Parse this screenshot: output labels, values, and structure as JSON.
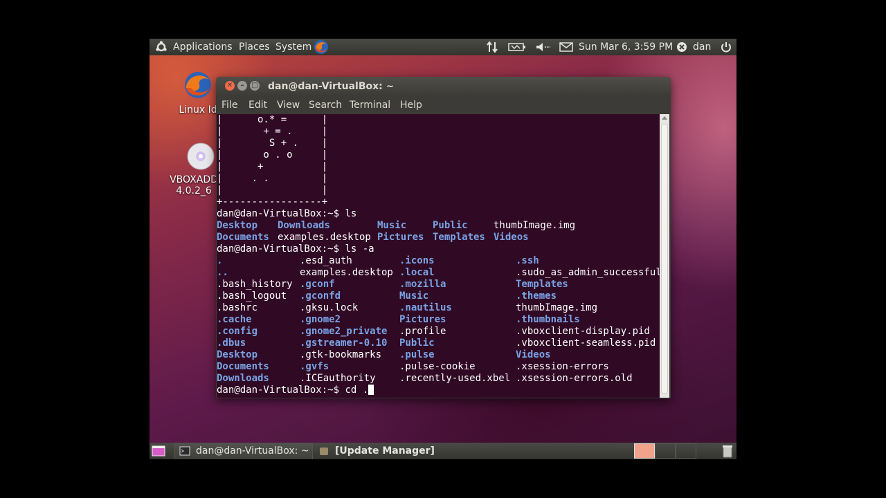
{
  "top_panel": {
    "menus": [
      "Applications",
      "Places",
      "System"
    ],
    "clock": "Sun Mar  6,  3:59 PM",
    "user": "dan"
  },
  "desktop_icons": [
    {
      "label_lines": [
        "Linux Id"
      ],
      "icon": "firefox-icon"
    },
    {
      "label_lines": [
        "VBOXADD",
        "4.0.2_6"
      ],
      "icon": "cd-icon"
    }
  ],
  "terminal": {
    "title": "dan@dan-VirtualBox: ~",
    "menu": [
      "File",
      "Edit",
      "View",
      "Search",
      "Terminal",
      "Help"
    ],
    "art_lines": [
      "|      o.* =      |",
      "|       + = .     |",
      "|        S + .    |",
      "|       o . o     |",
      "|      +          |",
      "|     . .         |",
      "|                 |",
      "+-----------------+"
    ],
    "prompt": "dan@dan-VirtualBox:~$",
    "cmd_ls": "ls",
    "ls_rows": [
      [
        {
          "t": "Desktop",
          "d": true
        },
        {
          "t": "Downloads",
          "d": true
        },
        {
          "t": "Music",
          "d": true
        },
        {
          "t": "Public",
          "d": true
        },
        {
          "t": "thumbImage.img",
          "d": false
        }
      ],
      [
        {
          "t": "Documents",
          "d": true
        },
        {
          "t": "examples.desktop",
          "d": false
        },
        {
          "t": "Pictures",
          "d": true
        },
        {
          "t": "Templates",
          "d": true
        },
        {
          "t": "Videos",
          "d": true
        }
      ]
    ],
    "cmd_ls_a": "ls -a",
    "ls_a_rows": [
      [
        {
          "t": ".",
          "d": true
        },
        {
          "t": ".esd_auth",
          "d": false
        },
        {
          "t": ".icons",
          "d": true
        },
        {
          "t": ".ssh",
          "d": true
        }
      ],
      [
        {
          "t": "..",
          "d": true
        },
        {
          "t": "examples.desktop",
          "d": false
        },
        {
          "t": ".local",
          "d": true
        },
        {
          "t": ".sudo_as_admin_successful",
          "d": false
        }
      ],
      [
        {
          "t": ".bash_history",
          "d": false
        },
        {
          "t": ".gconf",
          "d": true
        },
        {
          "t": ".mozilla",
          "d": true
        },
        {
          "t": "Templates",
          "d": true
        }
      ],
      [
        {
          "t": ".bash_logout",
          "d": false
        },
        {
          "t": ".gconfd",
          "d": true
        },
        {
          "t": "Music",
          "d": true
        },
        {
          "t": ".themes",
          "d": true
        }
      ],
      [
        {
          "t": ".bashrc",
          "d": false
        },
        {
          "t": ".gksu.lock",
          "d": false
        },
        {
          "t": ".nautilus",
          "d": true
        },
        {
          "t": "thumbImage.img",
          "d": false
        }
      ],
      [
        {
          "t": ".cache",
          "d": true
        },
        {
          "t": ".gnome2",
          "d": true
        },
        {
          "t": "Pictures",
          "d": true
        },
        {
          "t": ".thumbnails",
          "d": true
        }
      ],
      [
        {
          "t": ".config",
          "d": true
        },
        {
          "t": ".gnome2_private",
          "d": true
        },
        {
          "t": ".profile",
          "d": false
        },
        {
          "t": ".vboxclient-display.pid",
          "d": false
        }
      ],
      [
        {
          "t": ".dbus",
          "d": true
        },
        {
          "t": ".gstreamer-0.10",
          "d": true
        },
        {
          "t": "Public",
          "d": true
        },
        {
          "t": ".vboxclient-seamless.pid",
          "d": false
        }
      ],
      [
        {
          "t": "Desktop",
          "d": true
        },
        {
          "t": ".gtk-bookmarks",
          "d": false
        },
        {
          "t": ".pulse",
          "d": true
        },
        {
          "t": "Videos",
          "d": true
        }
      ],
      [
        {
          "t": "Documents",
          "d": true
        },
        {
          "t": ".gvfs",
          "d": true
        },
        {
          "t": ".pulse-cookie",
          "d": false
        },
        {
          "t": ".xsession-errors",
          "d": false
        }
      ],
      [
        {
          "t": "Downloads",
          "d": true
        },
        {
          "t": ".ICEauthority",
          "d": false
        },
        {
          "t": ".recently-used.xbel",
          "d": false
        },
        {
          "t": ".xsession-errors.old",
          "d": false
        }
      ]
    ],
    "current_input": "cd ."
  },
  "bottom_panel": {
    "tasks": [
      "dan@dan-VirtualBox: ~",
      "[Update Manager]"
    ]
  },
  "colors": {
    "terminal_bg": "#300a24",
    "directory": "#7aa3e5",
    "panel": "#3c3b37"
  }
}
